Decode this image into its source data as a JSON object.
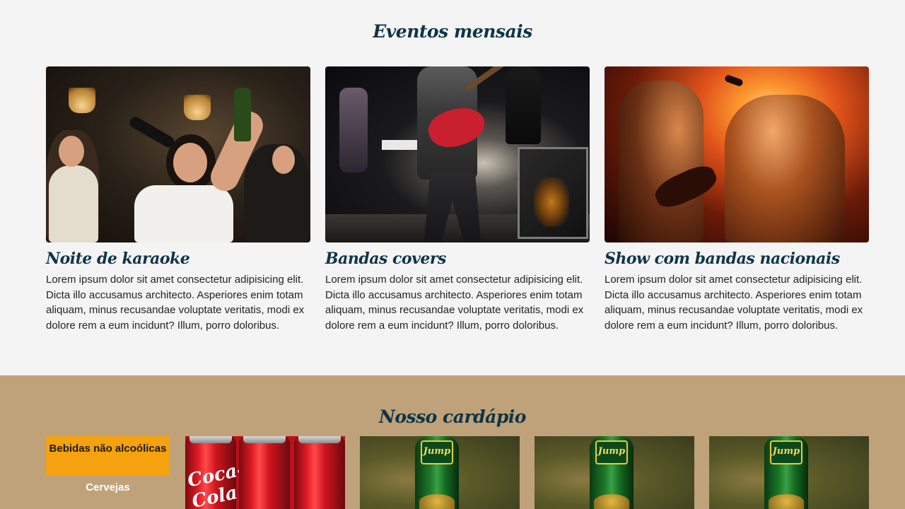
{
  "events": {
    "title": "Eventos mensais",
    "cards": [
      {
        "title": "Noite de karaoke",
        "text": "Lorem ipsum dolor sit amet consectetur adipisicing elit. Dicta illo accusamus architecto. Asperiores enim totam aliquam, minus recusandae voluptate veritatis, modi ex dolore rem a eum incidunt? Illum, porro doloribus."
      },
      {
        "title": "Bandas covers",
        "text": "Lorem ipsum dolor sit amet consectetur adipisicing elit. Dicta illo accusamus architecto. Asperiores enim totam aliquam, minus recusandae voluptate veritatis, modi ex dolore rem a eum incidunt? Illum, porro doloribus."
      },
      {
        "title": "Show com bandas nacionais",
        "text": "Lorem ipsum dolor sit amet consectetur adipisicing elit. Dicta illo accusamus architecto. Asperiores enim totam aliquam, minus recusandae voluptate veritatis, modi ex dolore rem a eum incidunt? Illum, porro doloribus."
      }
    ]
  },
  "menu": {
    "title": "Nosso cardápio",
    "tabs": [
      {
        "label": "Bebidas não alcoólicas",
        "active": true
      },
      {
        "label": "Cervejas",
        "active": false
      }
    ],
    "products": [
      {
        "logo_text": "Coca-Cola"
      },
      {
        "logo_text": "Jump"
      },
      {
        "logo_text": "Jump"
      },
      {
        "logo_text": "Jump"
      }
    ]
  },
  "colors": {
    "page_bg": "#f4f4f4",
    "menu_bg": "#bfa279",
    "heading": "#0f3448",
    "active_tab": "#f5a20e"
  }
}
